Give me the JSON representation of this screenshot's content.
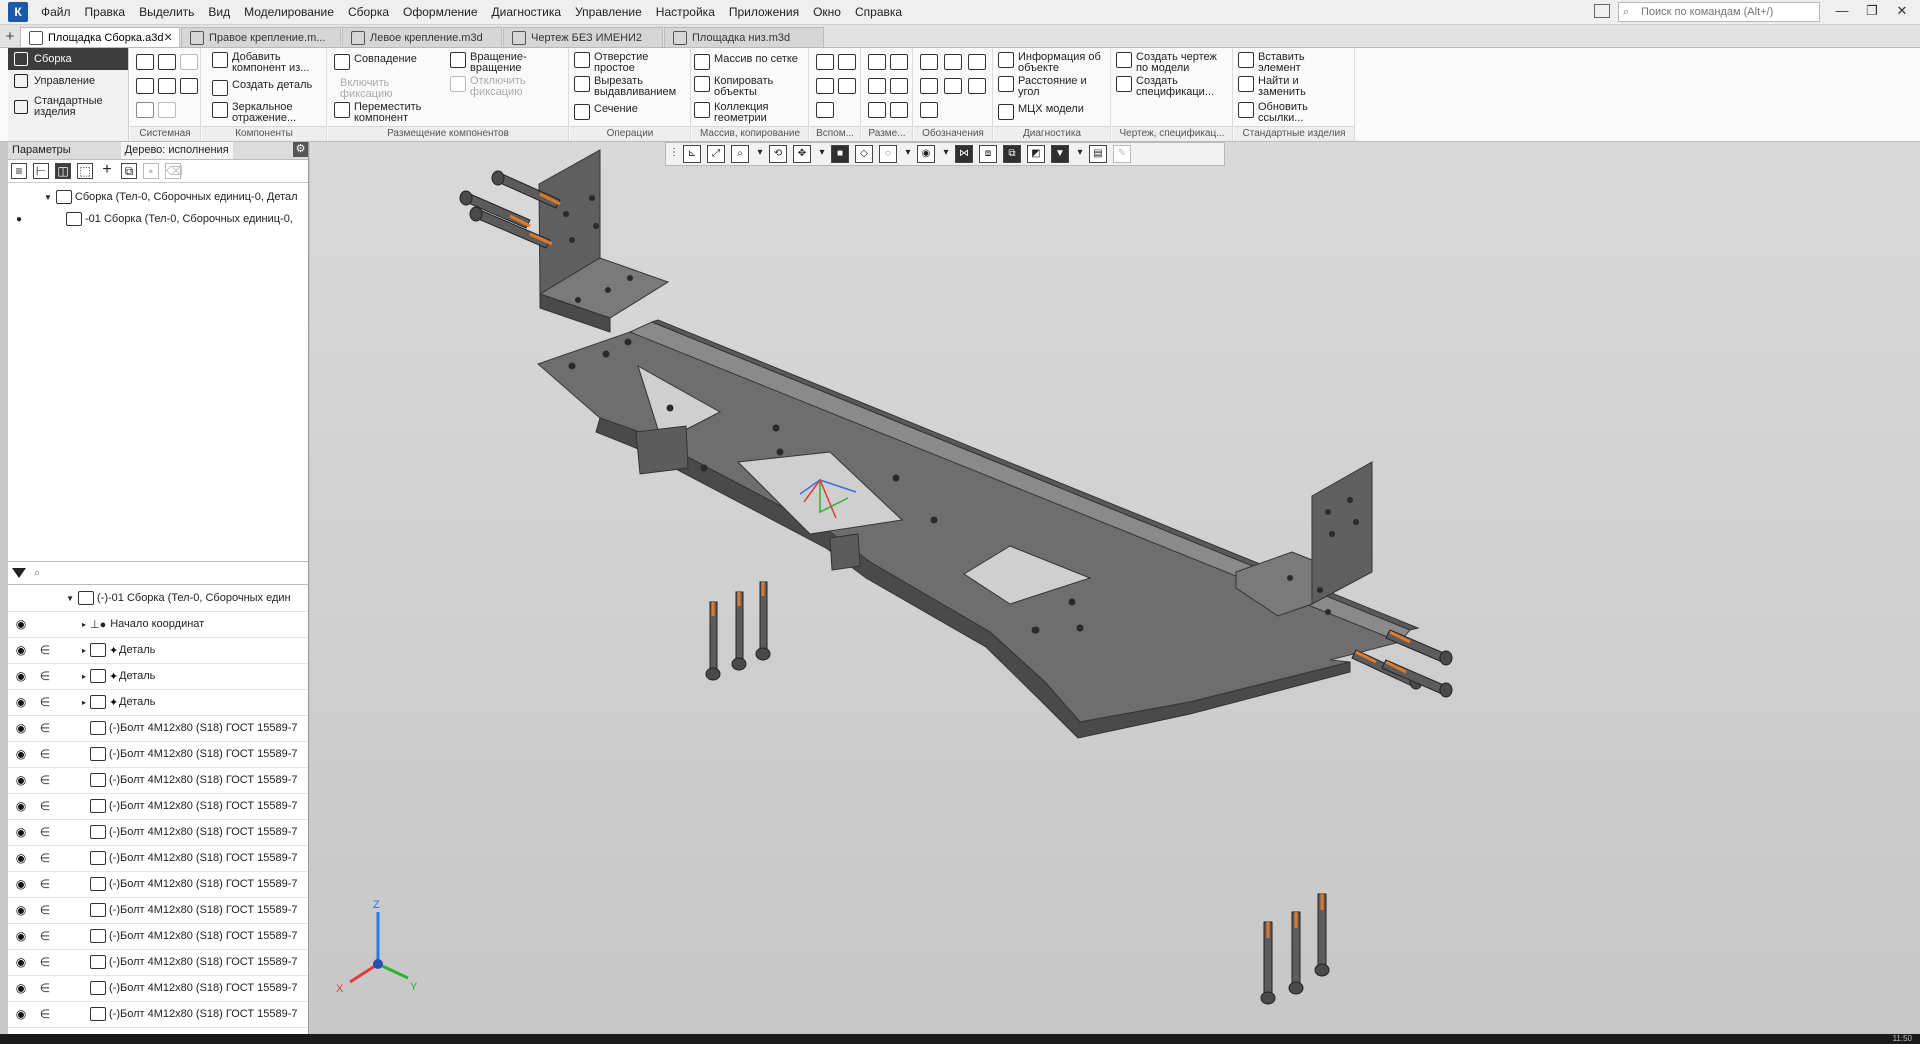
{
  "app": {
    "logo_letter": "К"
  },
  "menu": [
    "Файл",
    "Правка",
    "Выделить",
    "Вид",
    "Моделирование",
    "Сборка",
    "Оформление",
    "Диагностика",
    "Управление",
    "Настройка",
    "Приложения",
    "Окно",
    "Справка"
  ],
  "search": {
    "placeholder": "Поиск по командам (Alt+/)"
  },
  "window_controls": {
    "minimize": "—",
    "restore": "❐",
    "close": "✕"
  },
  "tabs": [
    {
      "label": "Площадка Сборка.a3d",
      "active": true,
      "close": "✕"
    },
    {
      "label": "Правое крепление.m..."
    },
    {
      "label": "Левое крепление.m3d"
    },
    {
      "label": "Чертеж БЕЗ ИМЕНИ2"
    },
    {
      "label": "Площадка низ.m3d"
    }
  ],
  "ribbon": {
    "left": [
      "Сборка",
      "Управление",
      "Стандартные изделия"
    ],
    "groups": {
      "system": "Системная",
      "components": "Компоненты",
      "placement": "Размещение компонентов",
      "operations": "Операции",
      "array": "Массив, копирование",
      "aux": "Вспом...",
      "dims": "Разме...",
      "notation": "Обозначения",
      "diagnostics": "Диагностика",
      "drawing": "Чертеж, спецификац...",
      "standard": "Стандартные изделия"
    },
    "buttons": {
      "add_component": "Добавить компонент из...",
      "create_part": "Создать деталь",
      "mirror": "Зеркальное отражение...",
      "coincidence": "Совпадение",
      "rotation": "Вращение-вращение",
      "enable_fix": "Включить фиксацию",
      "disable_fix": "Отключить фиксацию",
      "move_component": "Переместить компонент",
      "simple_hole": "Отверстие простое",
      "cut_extrude": "Вырезать выдавливанием",
      "section": "Сечение",
      "grid_array": "Массив по сетке",
      "copy_objects": "Копировать объекты",
      "geometry_collection": "Коллекция геометрии",
      "object_info": "Информация об объекте",
      "distance_angle": "Расстояние и угол",
      "mass_props": "МЦХ модели",
      "create_drawing": "Создать чертеж по модели",
      "create_spec": "Создать спецификаци...",
      "insert_element": "Вставить элемент",
      "find_replace": "Найти и заменить",
      "update_links": "Обновить ссылки..."
    }
  },
  "left_panel": {
    "tab_params": "Параметры",
    "tab_tree": "Дерево: исполнения",
    "gear": "⚙",
    "top_tree": [
      {
        "label": "Сборка (Тел-0, Сборочных единиц-0, Детал"
      },
      {
        "label": "-01 Сборка (Тел-0, Сборочных единиц-0,"
      }
    ],
    "bottom_tree": [
      {
        "label": "(-)-01 Сборка (Тел-0, Сборочных един"
      },
      {
        "label": "Начало координат"
      },
      {
        "label": "Деталь"
      },
      {
        "label": "Деталь"
      },
      {
        "label": "Деталь"
      },
      {
        "label": "(-)Болт 4М12х80 (S18) ГОСТ 15589-7"
      },
      {
        "label": "(-)Болт 4М12х80 (S18) ГОСТ 15589-7"
      },
      {
        "label": "(-)Болт 4М12х80 (S18) ГОСТ 15589-7"
      },
      {
        "label": "(-)Болт 4М12х80 (S18) ГОСТ 15589-7"
      },
      {
        "label": "(-)Болт 4М12х80 (S18) ГОСТ 15589-7"
      },
      {
        "label": "(-)Болт 4М12х80 (S18) ГОСТ 15589-7"
      },
      {
        "label": "(-)Болт 4М12х80 (S18) ГОСТ 15589-7"
      },
      {
        "label": "(-)Болт 4М12х80 (S18) ГОСТ 15589-7"
      },
      {
        "label": "(-)Болт 4М12х80 (S18) ГОСТ 15589-7"
      },
      {
        "label": "(-)Болт 4М12х80 (S18) ГОСТ 15589-7"
      },
      {
        "label": "(-)Болт 4М12х80 (S18) ГОСТ 15589-7"
      },
      {
        "label": "(-)Болт 4М12х80 (S18) ГОСТ 15589-7"
      }
    ]
  },
  "triad": {
    "x": "X",
    "y": "Y",
    "z": "Z"
  },
  "colors": {
    "accent": "#1b5aa8",
    "part_gray": "#6e6e6e",
    "part_dark": "#4a4a4a",
    "part_light": "#8a8a8a",
    "bolt": "#5c5c5c",
    "highlight_orange": "#e07a2a"
  },
  "status": {
    "clock": "11:50"
  }
}
